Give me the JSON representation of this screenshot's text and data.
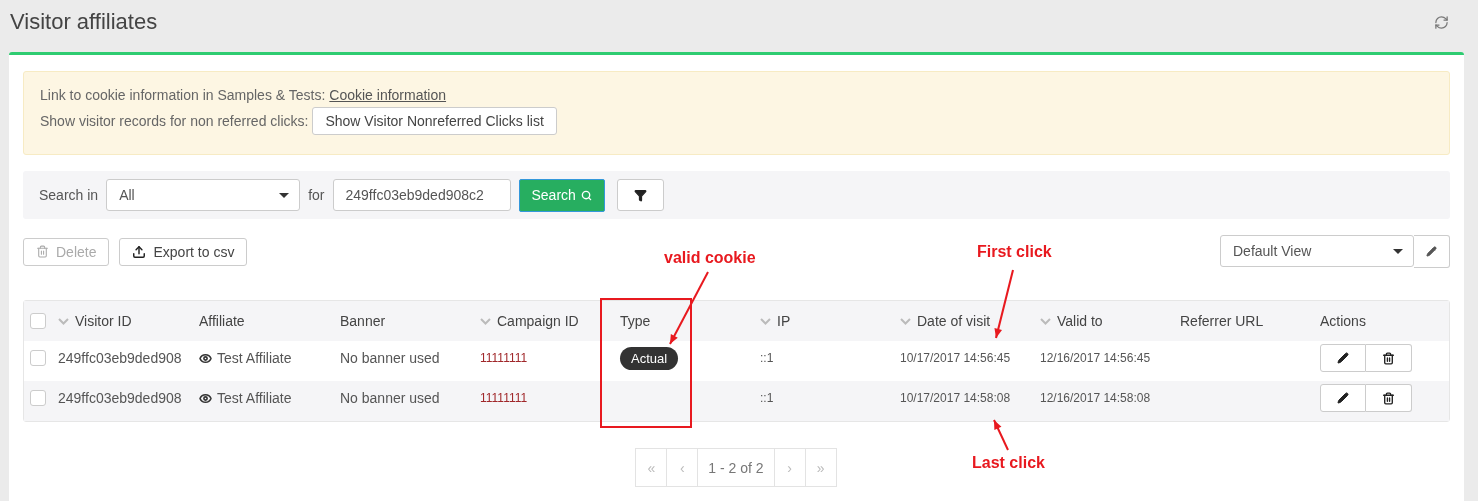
{
  "page": {
    "title": "Visitor affiliates"
  },
  "alert": {
    "line1": "Link to cookie information in Samples & Tests:",
    "link": "Cookie information",
    "line2": "Show visitor records for non referred clicks:",
    "button": "Show Visitor Nonreferred Clicks list"
  },
  "search": {
    "label": "Search in",
    "select": "All",
    "for_label": "for",
    "value": "249ffc03eb9ded908c2",
    "button": "Search"
  },
  "toolbar": {
    "buttons": [
      {
        "label": "Delete",
        "kind": "delete",
        "disabled": true
      },
      {
        "label": "Export to csv",
        "kind": "export",
        "disabled": false
      }
    ],
    "view": "Default View"
  },
  "table": {
    "select_all_checked": false,
    "columns": [
      {
        "label": "Visitor ID",
        "sortable": true
      },
      {
        "label": "Affiliate",
        "sortable": false
      },
      {
        "label": "Banner",
        "sortable": false
      },
      {
        "label": "Campaign ID",
        "sortable": true
      },
      {
        "label": "Type",
        "sortable": false
      },
      {
        "label": "IP",
        "sortable": true
      },
      {
        "label": "Date of visit",
        "sortable": true
      },
      {
        "label": "Valid to",
        "sortable": true
      },
      {
        "label": "Referrer URL",
        "sortable": false
      },
      {
        "label": "Actions",
        "sortable": false
      }
    ],
    "rows": [
      {
        "checked": false,
        "visitor_id": "249ffc03eb9ded908",
        "affiliate": "Test Affiliate",
        "banner": "No banner used",
        "campaign_id": "11111111",
        "type": "Actual",
        "ip": "::1",
        "date": "10/17/2017 14:56:45",
        "valid_to": "12/16/2017 14:56:45"
      },
      {
        "checked": false,
        "visitor_id": "249ffc03eb9ded908",
        "affiliate": "Test Affiliate",
        "banner": "No banner used",
        "campaign_id": "11111111",
        "ip": "::1",
        "date": "10/17/2017 14:58:08",
        "valid_to": "12/16/2017 14:58:08"
      }
    ]
  },
  "pagination": [
    {
      "label": "«",
      "disabled": true
    },
    {
      "label": "‹",
      "disabled": true
    },
    {
      "label": "1 - 2 of 2",
      "disabled": false
    },
    {
      "label": "›",
      "disabled": true
    },
    {
      "label": "»",
      "disabled": true
    }
  ],
  "annotations": [
    "valid cookie",
    "First click",
    "Last click"
  ]
}
